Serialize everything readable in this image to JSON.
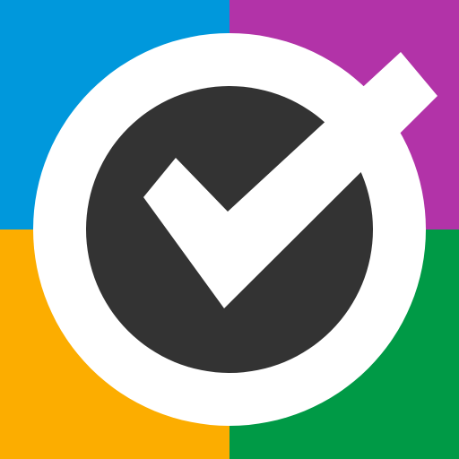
{
  "icon": {
    "name": "checkmark-app-icon",
    "colors": {
      "quadrant_top_left": "#0098dc",
      "quadrant_top_right": "#b233a8",
      "quadrant_bottom_left": "#fcad00",
      "quadrant_bottom_right": "#009a46",
      "ring": "#ffffff",
      "disc": "#333333",
      "checkmark": "#ffffff"
    }
  }
}
